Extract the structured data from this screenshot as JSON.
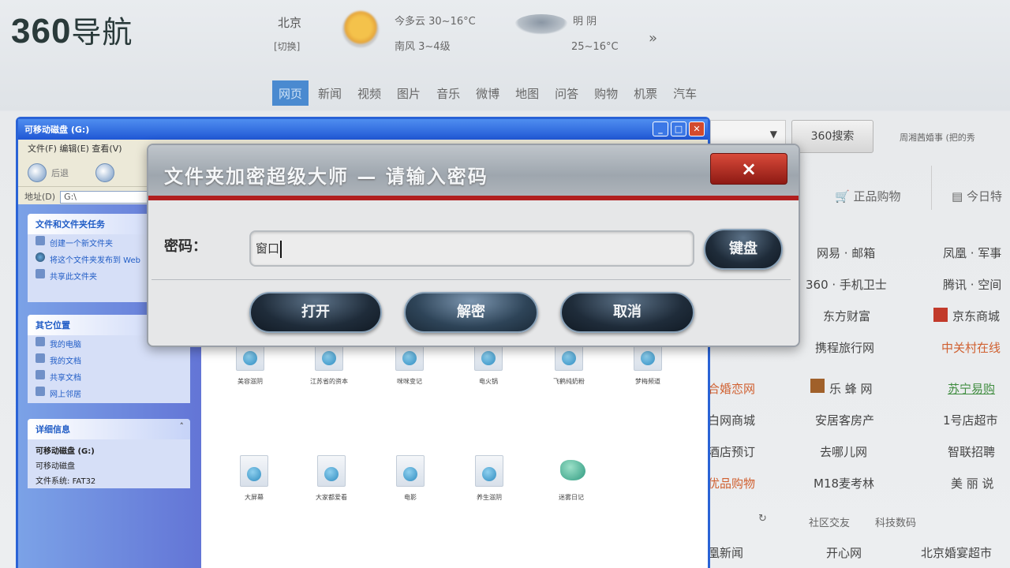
{
  "nav_page": {
    "logo_num": "360",
    "logo_text": "导航",
    "weather": {
      "city": "北京",
      "switch": "[切换]",
      "today": "今多云  30~16°C",
      "wind": "南风  3~4级",
      "tomorrow_label": "明 阴",
      "tomorrow_temp": "25~16°C",
      "more": "»"
    },
    "tabs": [
      "网页",
      "新闻",
      "视频",
      "图片",
      "音乐",
      "微博",
      "地图",
      "问答",
      "购物",
      "机票",
      "汽车"
    ],
    "search_dropdown": "▼",
    "search_button": "360搜索",
    "search_hint": "周湘茜婚事 (把的秀",
    "shop_tab_1": "正品购物",
    "shop_tab_2": "今日特",
    "links": [
      {
        "text": "网易 · 邮箱",
        "style": "normal"
      },
      {
        "text": "凤凰 · 军事",
        "style": "normal"
      },
      {
        "text": "360 · 手机卫士",
        "style": "normal"
      },
      {
        "text": "腾讯 · 空间",
        "style": "normal"
      },
      {
        "text": "东方财富",
        "style": "normal"
      },
      {
        "text": "京东商城",
        "style": "normal"
      },
      {
        "text": "携程旅行网",
        "style": "normal"
      },
      {
        "text": "中关村在线",
        "style": "orange"
      },
      {
        "text": "合婚恋网",
        "style": "orange"
      },
      {
        "text": "乐 蜂 网",
        "style": "normal"
      },
      {
        "text": "苏宁易购",
        "style": "green"
      },
      {
        "text": "白网商城",
        "style": "normal"
      },
      {
        "text": "安居客房产",
        "style": "normal"
      },
      {
        "text": "1号店超市",
        "style": "normal"
      },
      {
        "text": "酒店预订",
        "style": "normal"
      },
      {
        "text": "去哪儿网",
        "style": "normal"
      },
      {
        "text": "智联招聘",
        "style": "normal"
      },
      {
        "text": "优品购物",
        "style": "orange"
      },
      {
        "text": "M18麦考林",
        "style": "normal"
      },
      {
        "text": "美 丽 说",
        "style": "normal"
      },
      {
        "text": "凰新闻",
        "style": "normal"
      },
      {
        "text": "开心网",
        "style": "normal"
      },
      {
        "text": "北京婚宴超市",
        "style": "normal"
      }
    ],
    "social_1": "社区交友",
    "social_2": "科技数码"
  },
  "explorer": {
    "title": "可移动磁盘 (G:)",
    "menu": "文件(F)   编辑(E)   查看(V)",
    "back": "后退",
    "address_label": "地址(D)",
    "address_value": "G:\\",
    "tasks_title": "文件和文件夹任务",
    "tasks": [
      "创建一个新文件夹",
      "将这个文件夹发布到 Web",
      "共享此文件夹"
    ],
    "places_title": "其它位置",
    "places": [
      "我的电脑",
      "我的文档",
      "共享文档",
      "网上邻居"
    ],
    "details_title": "详细信息",
    "detail_name": "可移动磁盘 (G:)",
    "detail_type": "可移动磁盘",
    "detail_fs_label": "文件系统:",
    "detail_fs_value": "FAT32",
    "files_row1": [
      "美容滋阴",
      "江苏省的资本",
      "咪咪变记",
      "电火锅",
      "飞鹤纯奶粉",
      "梦梅频道"
    ],
    "files_row2": [
      "大屏幕",
      "大家都爱看",
      "电影",
      "养生滋阴",
      "迷雾日记"
    ]
  },
  "dialog": {
    "title": "文件夹加密超级大师 — 请输入密码",
    "close": "×",
    "password_label": "密码：",
    "password_value": "窗口",
    "keyboard": "键盘",
    "open": "打开",
    "decrypt": "解密",
    "cancel": "取消"
  }
}
